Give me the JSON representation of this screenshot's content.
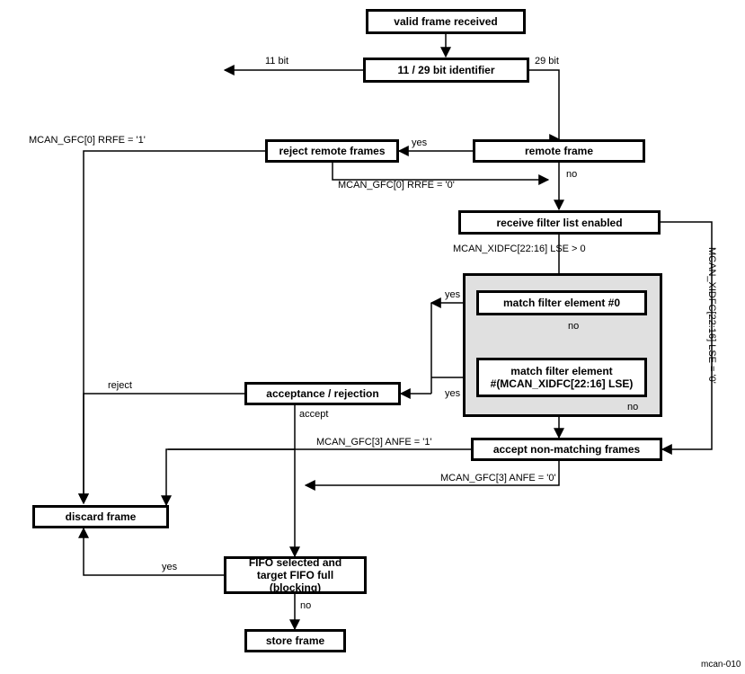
{
  "nodes": {
    "valid_frame_received": "valid frame received",
    "identifier": "11 / 29 bit identifier",
    "reject_remote": "reject remote frames",
    "remote_frame": "remote frame",
    "receive_filter_list": "receive filter list enabled",
    "match_filter_0": "match filter element #0",
    "match_filter_n": "match filter element\n#(MCAN_XIDFC[22:16] LSE)",
    "acceptance_rejection": "acceptance / rejection",
    "discard_frame": "discard frame",
    "accept_nonmatching": "accept non-matching frames",
    "fifo_block": "FIFO selected and\ntarget FIFO full (blocking)",
    "store_frame": "store frame"
  },
  "labels": {
    "bit11": "11 bit",
    "bit29": "29 bit",
    "rrfe_1": "MCAN_GFC[0] RRFE = '1'",
    "rrfe_0": "MCAN_GFC[0] RRFE = '0'",
    "lse_gt0": "MCAN_XIDFC[22:16] LSE > 0",
    "lse_eq0": "MCAN_XIDFC[22:16] LSE = '0'",
    "anfe_1": "MCAN_GFC[3] ANFE = '1'",
    "anfe_0": "MCAN_GFC[3] ANFE = '0'",
    "yes": "yes",
    "no": "no",
    "reject": "reject",
    "accept": "accept"
  },
  "footer": "mcan-010"
}
